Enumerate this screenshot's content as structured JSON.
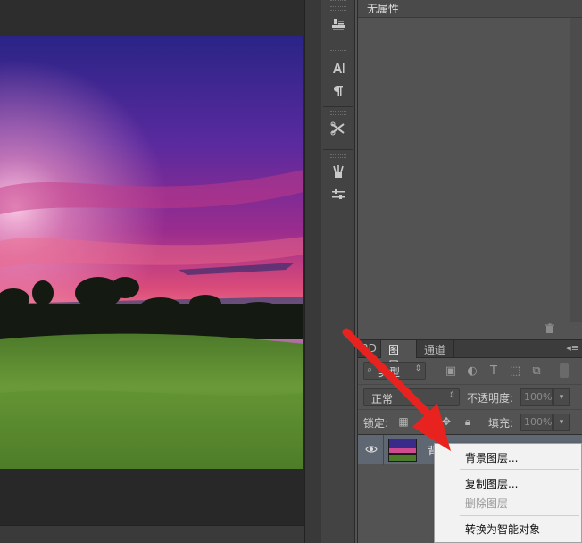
{
  "properties_panel": {
    "title": "无属性"
  },
  "layers_panel": {
    "tabs": [
      {
        "label": "3D",
        "active": false
      },
      {
        "label": "图层",
        "active": true
      },
      {
        "label": "通道",
        "active": false
      }
    ],
    "filter": {
      "kind_label": "类型",
      "search_glyph": "⌕"
    },
    "blend": {
      "mode": "正常",
      "opacity_label": "不透明度:",
      "opacity_value": "100%"
    },
    "lock": {
      "label": "锁定:",
      "fill_label": "填充:",
      "fill_value": "100%"
    },
    "layer": {
      "name": "背",
      "visible": true
    }
  },
  "context_menu": {
    "items": [
      {
        "label": "背景图层...",
        "disabled": false
      },
      {
        "label": "复制图层...",
        "disabled": false
      },
      {
        "label": "删除图层",
        "disabled": true
      },
      {
        "label": "转换为智能对象",
        "disabled": false
      }
    ]
  },
  "colors": {
    "annotation_arrow": "#e8231f",
    "selected_layer": "#5f6772",
    "panel_bg": "#535353"
  },
  "toolstrip_icons": [
    "stamp-icon",
    "character-icon",
    "paragraph-icon",
    "tools-icon",
    "brush-presets-icon",
    "sliders-icon"
  ]
}
